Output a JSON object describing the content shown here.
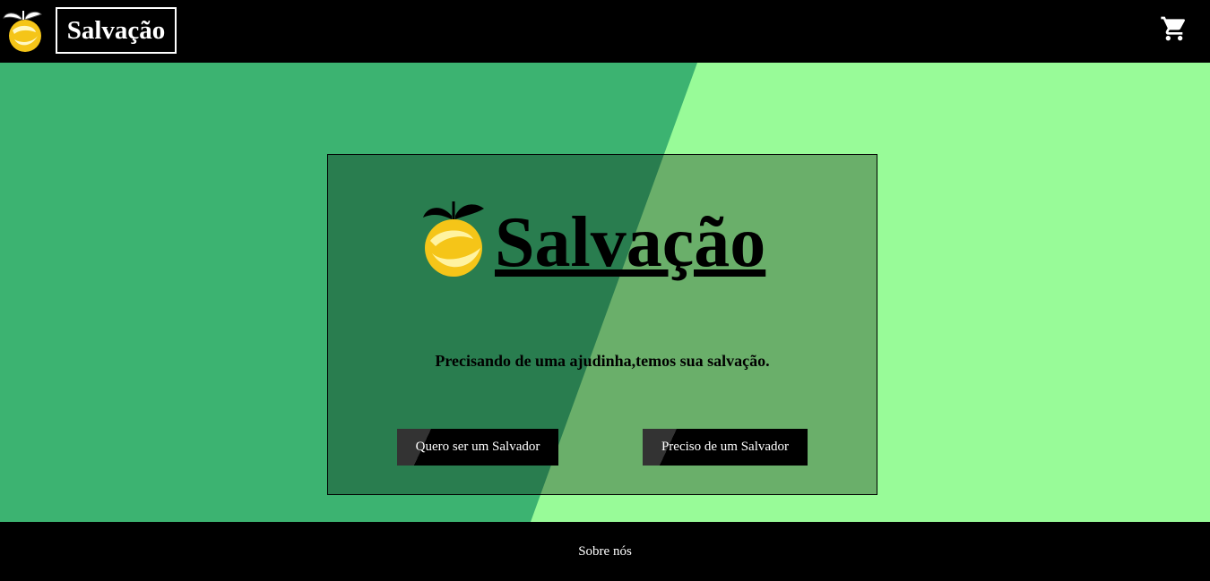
{
  "header": {
    "brand": "Salvação",
    "logo_icon": "lemon-logo-icon",
    "cart_icon": "shopping-cart-icon"
  },
  "hero": {
    "title": "Salvação",
    "tagline": "Precisando de uma ajudinha,temos sua salvação.",
    "buttons": {
      "saver": "Quero ser um Salvador",
      "need": "Preciso de um Salvador"
    }
  },
  "footer": {
    "about": "Sobre nós"
  },
  "colors": {
    "dark_green": "#3cb371",
    "light_green": "#98fb98",
    "lemon": "#f5c518",
    "black": "#000000",
    "white": "#ffffff"
  }
}
